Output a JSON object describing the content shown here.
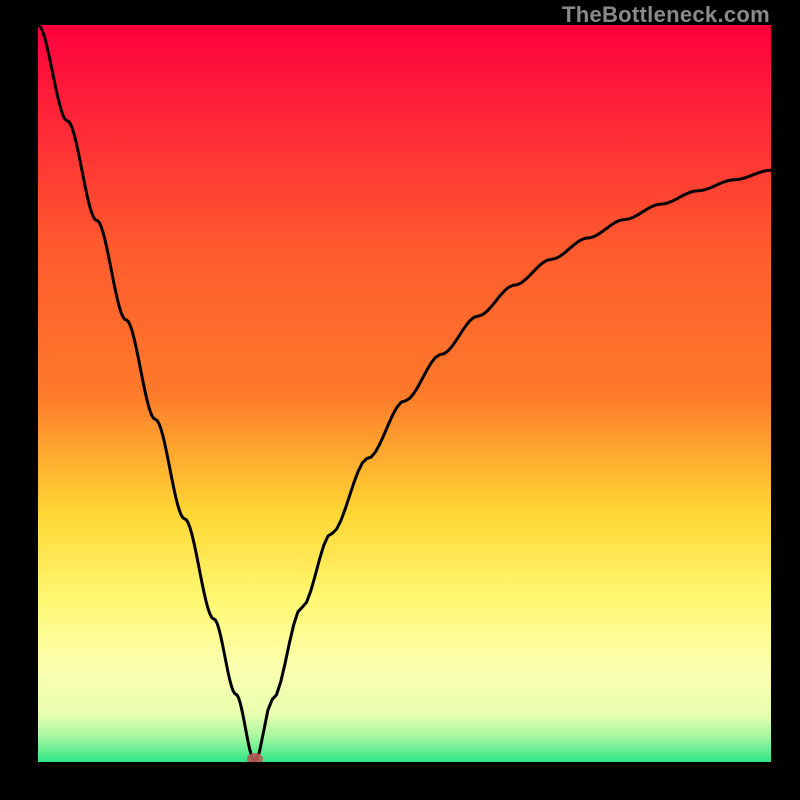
{
  "watermark": "TheBottleneck.com",
  "colors": {
    "top": "#ff003e",
    "mid1": "#ff7a2a",
    "mid2": "#ffd633",
    "mid3": "#fff872",
    "mid4": "#fdffb0",
    "bottom": "#2fe687",
    "curve": "#000000",
    "marker": "#b85a54"
  },
  "chart_data": {
    "type": "line",
    "title": "",
    "xlabel": "",
    "ylabel": "",
    "xlim": [
      0,
      100
    ],
    "ylim": [
      0,
      100
    ],
    "series": [
      {
        "name": "bottleneck-curve",
        "x": [
          0,
          4,
          8,
          12,
          16,
          20,
          24,
          27,
          29.6,
          32,
          36,
          40,
          45,
          50,
          55,
          60,
          65,
          70,
          75,
          80,
          85,
          90,
          95,
          100
        ],
        "y": [
          100,
          87,
          73.5,
          60,
          46.5,
          33,
          19.4,
          9.2,
          0,
          8.5,
          21,
          31,
          41.2,
          49,
          55.3,
          60.5,
          64.7,
          68.2,
          71.1,
          73.6,
          75.7,
          77.5,
          79,
          80.3
        ]
      }
    ],
    "annotations": [
      {
        "type": "marker",
        "x": 29.6,
        "y": 0,
        "shape": "dot",
        "color": "#b85a54"
      }
    ]
  }
}
